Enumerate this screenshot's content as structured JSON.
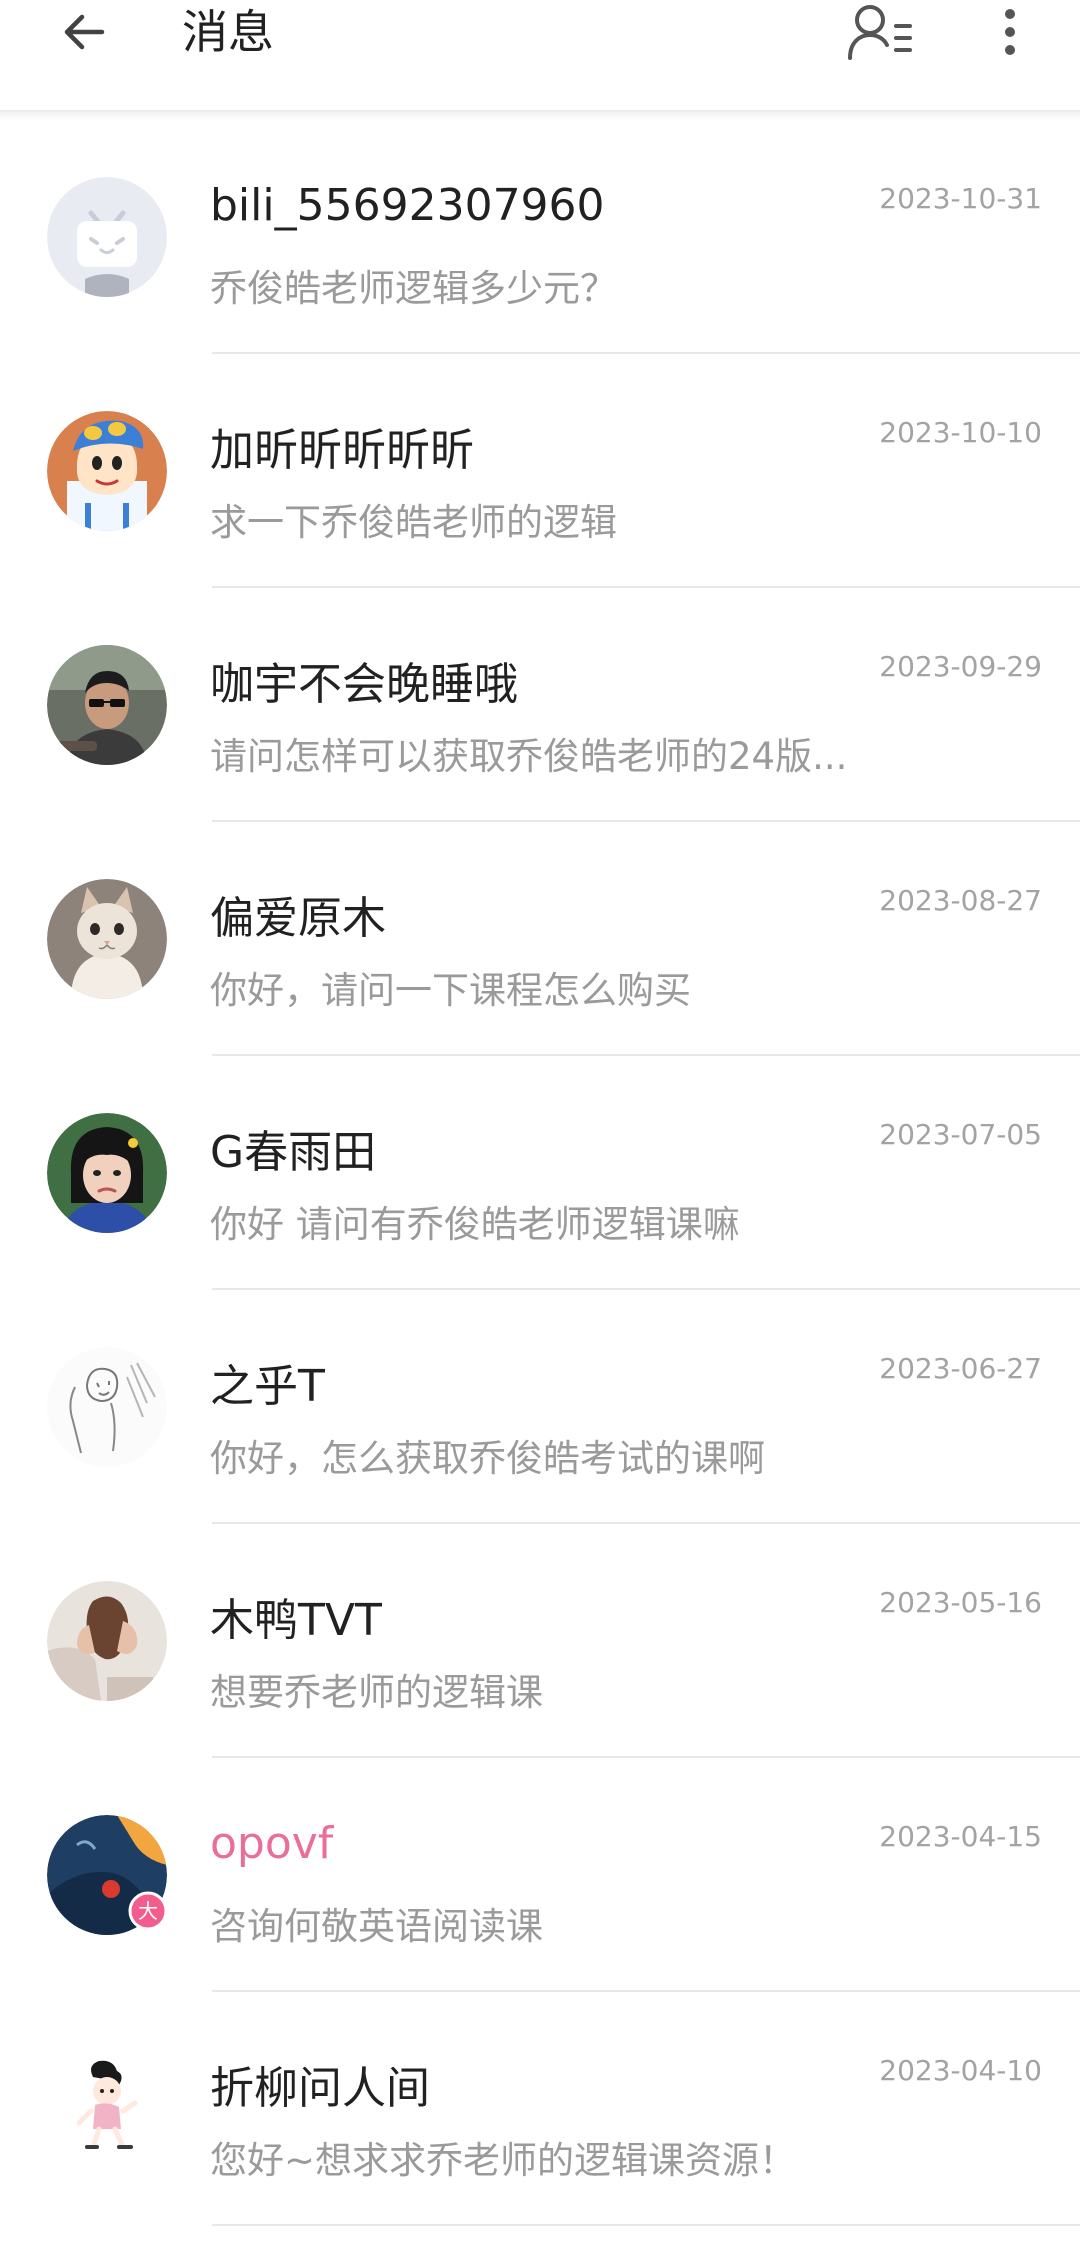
{
  "header": {
    "title": "消息",
    "back_icon": "arrow-left-icon",
    "contacts_icon": "user-list-icon",
    "more_icon": "more-vertical-icon"
  },
  "messages": [
    {
      "name": "bili_55692307960",
      "preview": "乔俊皓老师逻辑多少元？",
      "date": "2023-10-31",
      "avatar": "bilibili-tv-default-avatar"
    },
    {
      "name": "加昕昕昕昕昕",
      "preview": "求一下乔俊皓老师的逻辑",
      "date": "2023-10-10",
      "avatar": "cartoon-boy-avatar"
    },
    {
      "name": "咖宇不会晚睡哦",
      "preview": "请问怎样可以获取乔俊皓老师的24版...",
      "date": "2023-09-29",
      "avatar": "man-with-glasses-avatar"
    },
    {
      "name": "偏爱原木",
      "preview": "你好，请问一下课程怎么购买",
      "date": "2023-08-27",
      "avatar": "kitten-avatar"
    },
    {
      "name": "G春雨田",
      "preview": "你好 请问有乔俊皓老师逻辑课嘛",
      "date": "2023-07-05",
      "avatar": "girl-photo-avatar"
    },
    {
      "name": "之乎T",
      "preview": "你好，怎么获取乔俊皓考试的课啊",
      "date": "2023-06-27",
      "avatar": "sketch-avatar"
    },
    {
      "name": "木鸭TVT",
      "preview": "想要乔老师的逻辑课",
      "date": "2023-05-16",
      "avatar": "hands-photo-avatar"
    },
    {
      "name": "opovf",
      "preview": "咨询何敬英语阅读课",
      "date": "2023-04-15",
      "avatar": "blue-photo-avatar",
      "vip": true,
      "badge": "大"
    },
    {
      "name": "折柳问人间",
      "preview": "您好~想求求乔老师的逻辑课资源！",
      "date": "2023-04-10",
      "avatar": "cartoon-girl-avatar"
    }
  ],
  "colors": {
    "vip_name": "#e96e9a",
    "vip_badge": "#f25d8e",
    "text_primary": "#212121",
    "text_secondary": "#9a9a9a",
    "date": "#a3a3a3",
    "divider": "#e8e8e8"
  }
}
